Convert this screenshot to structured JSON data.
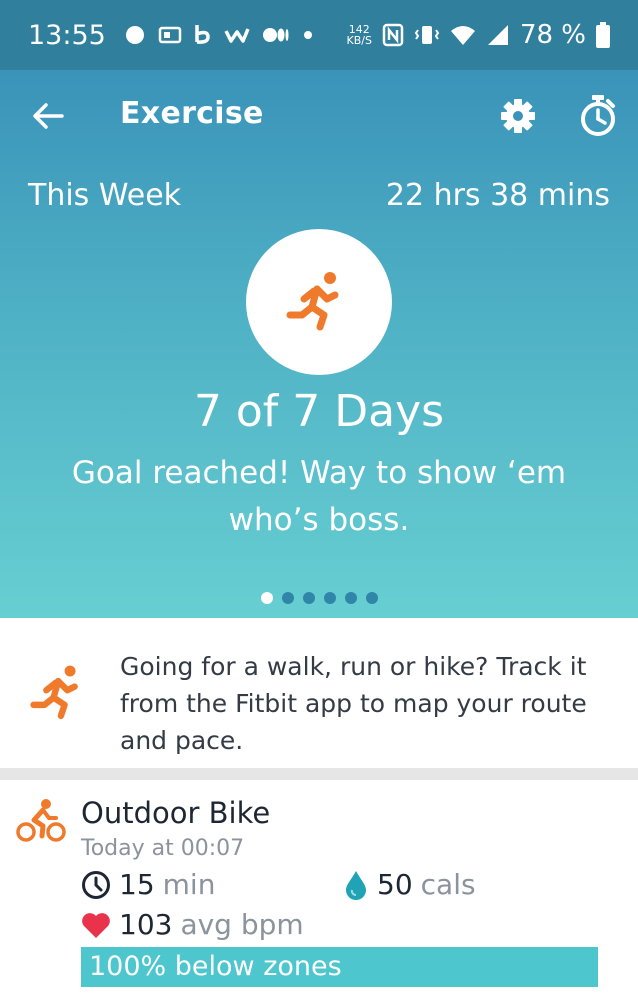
{
  "status_bar": {
    "time": "13:55",
    "net_speed_value": "142",
    "net_speed_unit": "KB/S",
    "battery": "78 %"
  },
  "header": {
    "title": "Exercise",
    "week_label": "This Week",
    "week_total": "22 hrs 38 mins"
  },
  "summary": {
    "days": "7 of 7 Days",
    "goal_message": "Goal reached! Way to show ‘em who’s boss.",
    "page_count": 6,
    "active_page": 1
  },
  "tip": {
    "text": "Going for a walk, run or hike? Track it from the Fitbit app to map your route and pace."
  },
  "activity": {
    "name": "Outdoor Bike",
    "time": "Today at 00:07",
    "duration_value": "15",
    "duration_unit": "min",
    "cals_value": "50",
    "cals_unit": "cals",
    "bpm_value": "103",
    "bpm_unit": "avg bpm",
    "zones": "100% below zones"
  },
  "colors": {
    "accent_orange": "#f07a2c",
    "zone_teal": "#4ec6ce",
    "heart_red": "#e8334a",
    "drop_teal": "#1fa3b5"
  }
}
